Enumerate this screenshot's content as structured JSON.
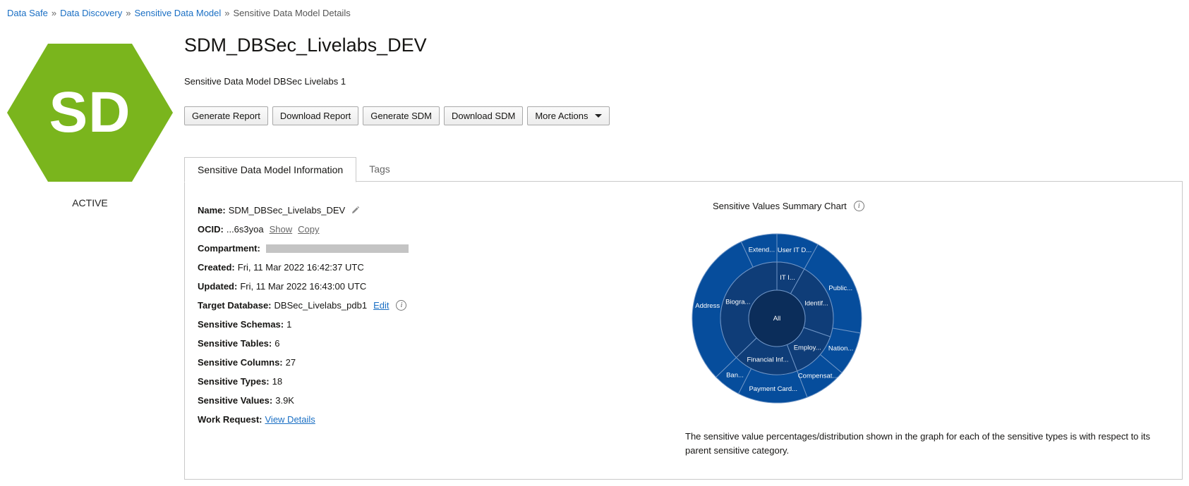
{
  "breadcrumb": {
    "items": [
      "Data Safe",
      "Data Discovery",
      "Sensitive Data Model"
    ],
    "separator": "»",
    "current": "Sensitive Data Model Details"
  },
  "resource": {
    "initials": "SD",
    "status": "ACTIVE",
    "color": "#7ab51d",
    "title": "SDM_DBSec_Livelabs_DEV",
    "description": "Sensitive Data Model DBSec Livelabs 1"
  },
  "actions": {
    "generate_report": "Generate Report",
    "download_report": "Download Report",
    "generate_sdm": "Generate SDM",
    "download_sdm": "Download SDM",
    "more_actions": "More Actions"
  },
  "tabs": {
    "info": "Sensitive Data Model Information",
    "tags": "Tags"
  },
  "info": {
    "name_label": "Name:",
    "name_value": "SDM_DBSec_Livelabs_DEV",
    "ocid_label": "OCID:",
    "ocid_value": "...6s3yoa",
    "ocid_show": "Show",
    "ocid_copy": "Copy",
    "compartment_label": "Compartment:",
    "created_label": "Created:",
    "created_value": "Fri, 11 Mar 2022 16:42:37 UTC",
    "updated_label": "Updated:",
    "updated_value": "Fri, 11 Mar 2022 16:43:00 UTC",
    "target_db_label": "Target Database:",
    "target_db_value": "DBSec_Livelabs_pdb1",
    "target_db_edit": "Edit",
    "schemas_label": "Sensitive Schemas:",
    "schemas_value": "1",
    "tables_label": "Sensitive Tables:",
    "tables_value": "6",
    "columns_label": "Sensitive Columns:",
    "columns_value": "27",
    "types_label": "Sensitive Types:",
    "types_value": "18",
    "values_label": "Sensitive Values:",
    "values_value": "3.9K",
    "work_request_label": "Work Request:",
    "work_request_link": "View Details"
  },
  "chart": {
    "title": "Sensitive Values Summary Chart",
    "note": "The sensitive value percentages/distribution shown in the graph for each of the sensitive types is with respect to its parent sensitive category.",
    "colors": {
      "center": "#0b2d5a",
      "middle": "#0f3d78",
      "outer": "#064d9c",
      "line": "#6f95c6"
    }
  },
  "chart_data": {
    "type": "sunburst",
    "center": "All",
    "categories": [
      {
        "label": "IT I...",
        "start": 0,
        "end": 29
      },
      {
        "label": "Identif...",
        "start": 29,
        "end": 109
      },
      {
        "label": "Employ...",
        "start": 109,
        "end": 159
      },
      {
        "label": "Financial Inf...",
        "start": 159,
        "end": 226
      },
      {
        "label": "Biogra...",
        "start": 226,
        "end": 360
      }
    ],
    "types": [
      {
        "label": "User IT D...",
        "start": 0,
        "end": 29
      },
      {
        "label": "Public...",
        "start": 29,
        "end": 100
      },
      {
        "label": "Nation...",
        "start": 100,
        "end": 130
      },
      {
        "label": "Compensat...",
        "start": 130,
        "end": 159
      },
      {
        "label": "Payment Card...",
        "start": 159,
        "end": 207
      },
      {
        "label": "Ban...",
        "start": 207,
        "end": 226
      },
      {
        "label": "Address",
        "start": 226,
        "end": 335
      },
      {
        "label": "Extend...",
        "start": 335,
        "end": 360
      }
    ]
  }
}
